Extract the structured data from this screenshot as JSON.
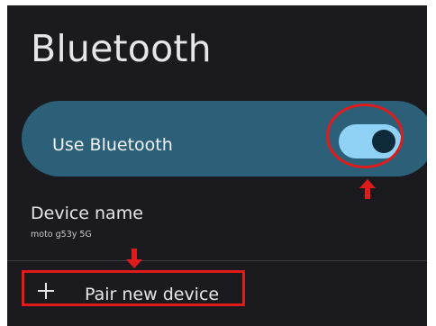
{
  "page": {
    "title": "Bluetooth"
  },
  "use_bluetooth": {
    "label": "Use Bluetooth",
    "enabled": true
  },
  "device_name": {
    "title": "Device name",
    "value": "moto g53y 5G"
  },
  "pair": {
    "label": "Pair new device",
    "icon": "plus-icon"
  },
  "colors": {
    "background": "#1b1b1f",
    "card": "#2c5f78",
    "toggle_track": "#8fd2f5",
    "toggle_knob": "#0e2a3a",
    "annotation": "#e01b1b"
  }
}
